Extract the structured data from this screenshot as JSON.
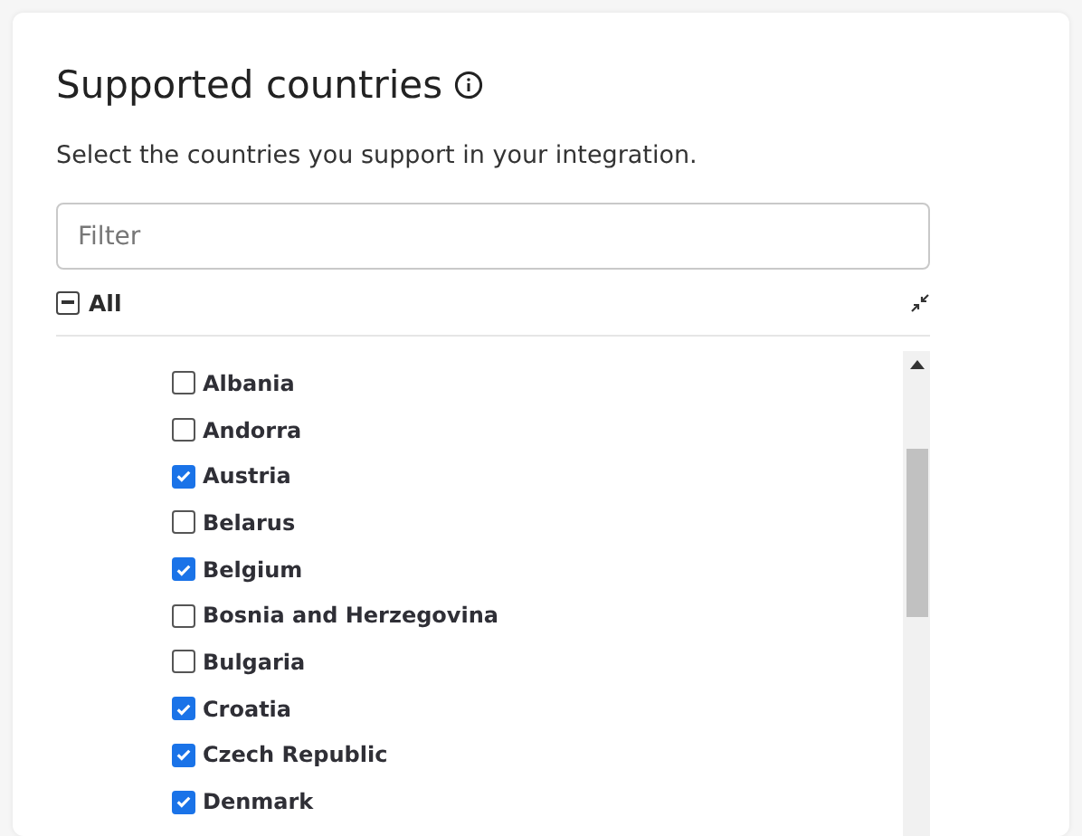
{
  "title": "Supported countries",
  "description": "Select the countries you support in your integration.",
  "filter": {
    "placeholder": "Filter"
  },
  "all": {
    "label": "All",
    "indeterminate": true
  },
  "countries": [
    {
      "name": "Albania",
      "checked": false
    },
    {
      "name": "Andorra",
      "checked": false
    },
    {
      "name": "Austria",
      "checked": true
    },
    {
      "name": "Belarus",
      "checked": false
    },
    {
      "name": "Belgium",
      "checked": true
    },
    {
      "name": "Bosnia and Herzegovina",
      "checked": false
    },
    {
      "name": "Bulgaria",
      "checked": false
    },
    {
      "name": "Croatia",
      "checked": true
    },
    {
      "name": "Czech Republic",
      "checked": true
    },
    {
      "name": "Denmark",
      "checked": true
    }
  ]
}
